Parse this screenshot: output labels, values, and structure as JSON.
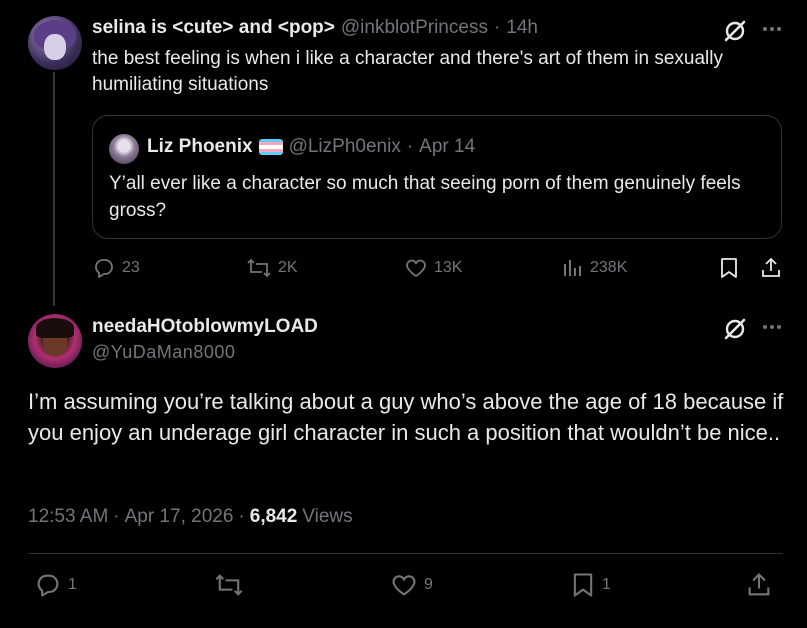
{
  "parent": {
    "display_name": "selina is <cute> and <pop>",
    "handle": "@inkblotPrincess",
    "separator": "·",
    "time": "14h",
    "text": "the best feeling is when i like a character and there's art of them in sexually humiliating situations",
    "quote": {
      "display_name": "Liz Phoenix",
      "handle": "@LizPh0enix",
      "separator": "·",
      "date": "Apr 14",
      "text": "Y’all ever like a character so much that seeing porn of them genuinely feels gross?",
      "flag_colors": [
        "#5bcefa",
        "#f5a9b8",
        "#ffffff",
        "#f5a9b8",
        "#5bcefa"
      ]
    },
    "actions": {
      "replies": "23",
      "reposts": "2K",
      "likes": "13K",
      "views": "238K"
    }
  },
  "reply": {
    "display_name": "needaHOtoblowmyLOAD",
    "handle": "@YuDaMan8000",
    "text": "I’m assuming you’re talking about a guy who’s above the age of 18 because if you enjoy an underage girl character in such a position that wouldn’t be nice..",
    "time": "12:53 AM",
    "separator": "·",
    "date": "Apr 17, 2026",
    "views_count": "6,842",
    "views_label": "Views",
    "actions": {
      "replies": "1",
      "likes": "9",
      "bookmarks": "1"
    }
  },
  "colors": {
    "background": "#000000",
    "text": "#e7e9ea",
    "muted": "#71767b",
    "border": "#2f3336"
  }
}
